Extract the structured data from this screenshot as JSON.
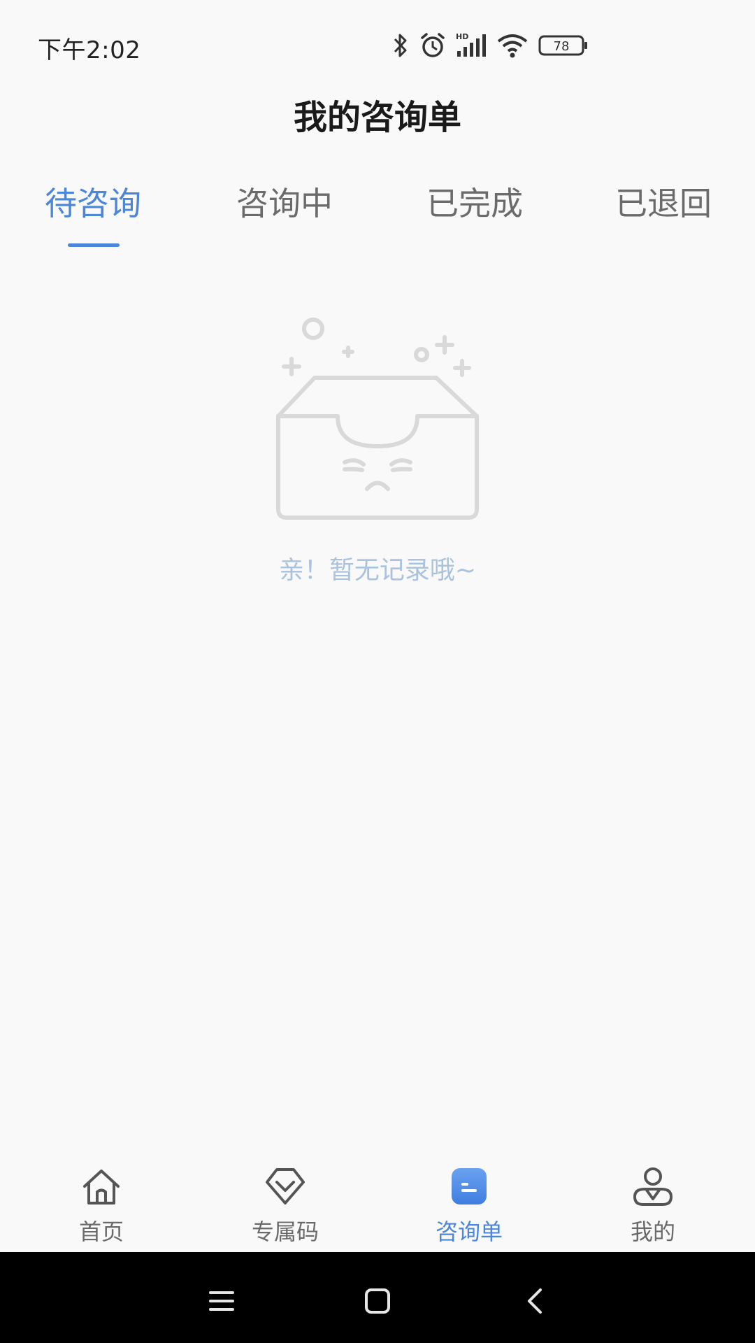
{
  "status_bar": {
    "time": "下午2:02",
    "battery": "78",
    "icons": [
      "bluetooth-icon",
      "alarm-icon",
      "hd-signal-icon",
      "wifi-icon",
      "battery-icon"
    ]
  },
  "header": {
    "title": "我的咨询单"
  },
  "tabs": [
    {
      "label": "待咨询",
      "active": true
    },
    {
      "label": "咨询中",
      "active": false
    },
    {
      "label": "已完成",
      "active": false
    },
    {
      "label": "已退回",
      "active": false
    }
  ],
  "empty_state": {
    "icon": "empty-box-icon",
    "message": "亲！暂无记录哦~"
  },
  "bottom_nav": [
    {
      "label": "首页",
      "icon": "home-icon",
      "active": false
    },
    {
      "label": "专属码",
      "icon": "badge-code-icon",
      "active": false
    },
    {
      "label": "咨询单",
      "icon": "consult-list-icon",
      "active": true
    },
    {
      "label": "我的",
      "icon": "profile-icon",
      "active": false
    }
  ],
  "system_nav": [
    "menu-icon",
    "home-square-icon",
    "back-icon"
  ],
  "colors": {
    "accent": "#4c86d8",
    "background": "#f9f9fa",
    "inactive_text": "#6b6b6b",
    "empty_text": "#a9c2de",
    "system_bar": "#000000"
  }
}
